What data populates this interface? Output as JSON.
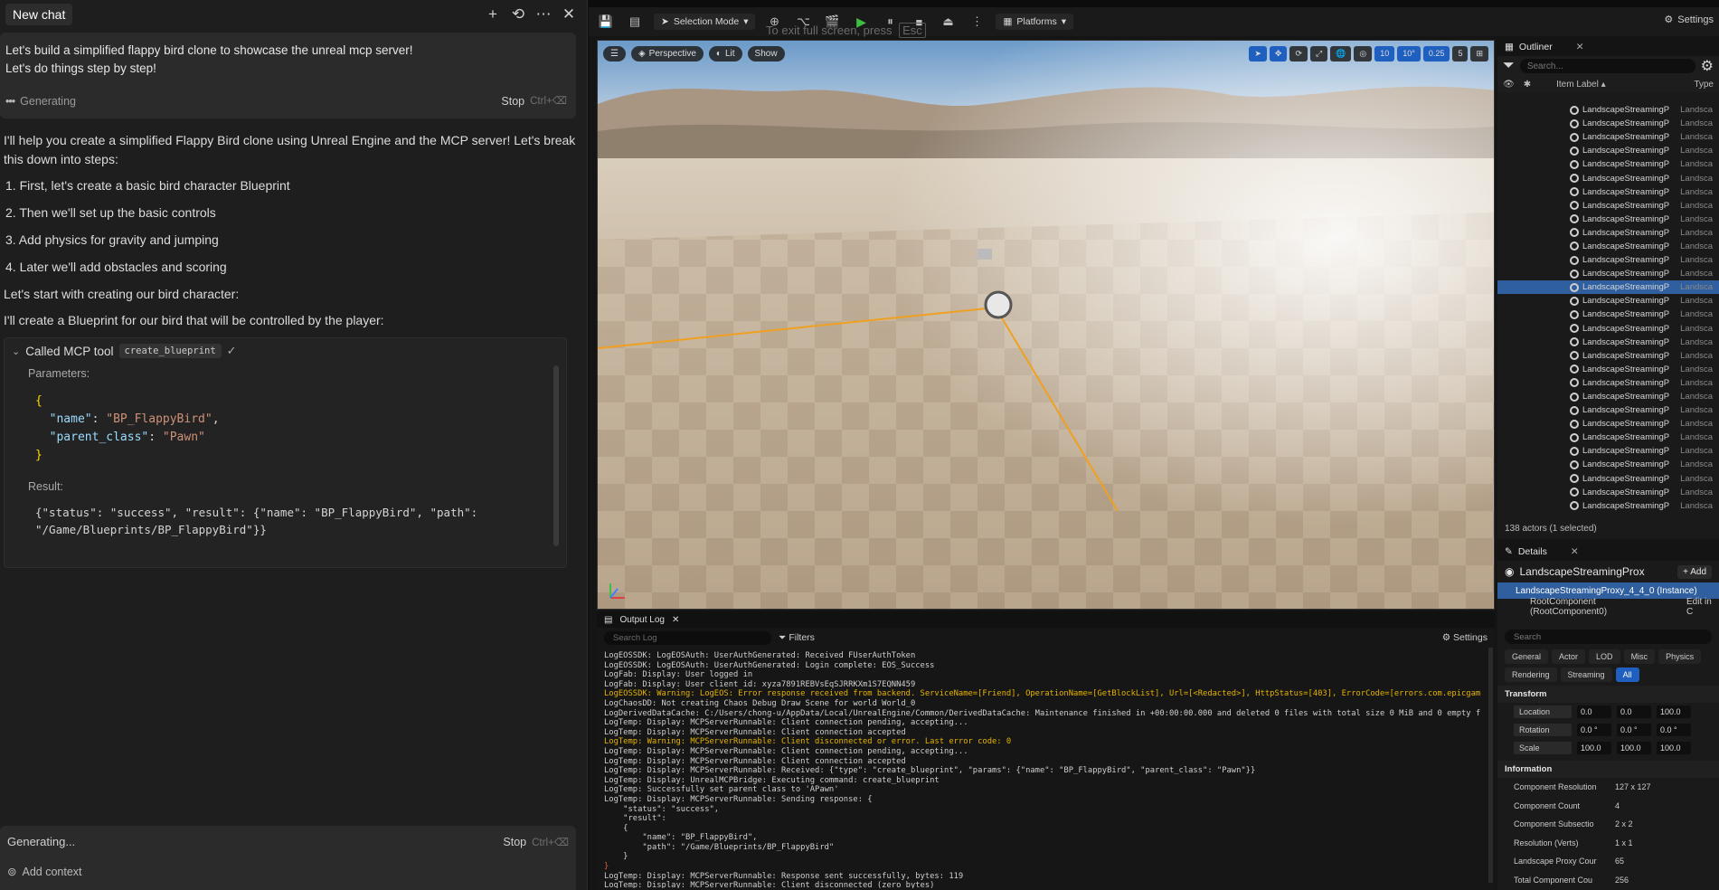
{
  "chat": {
    "title": "New chat",
    "header_icons": [
      "plus-icon",
      "history-icon",
      "more-icon",
      "close-icon"
    ],
    "user_message": {
      "line1": "Let's build a simplified flappy bird clone to showcase the unreal mcp server!",
      "line2": "Let's do things step by step!"
    },
    "status": "Generating",
    "stop_label": "Stop",
    "stop_shortcut": "Ctrl+⌫",
    "assistant": {
      "intro": "I'll help you create a simplified Flappy Bird clone using Unreal Engine and the MCP server! Let's break this down into steps:",
      "steps": [
        "1. First, let's create a basic bird character Blueprint",
        "2. Then we'll set up the basic controls",
        "3. Add physics for gravity and jumping",
        "4. Later we'll add obstacles and scoring"
      ],
      "para1": "Let's start with creating our bird character:",
      "para2": "I'll create a Blueprint for our bird that will be controlled by the player:"
    },
    "tool_call": {
      "label": "Called MCP tool",
      "tool_name": "create_blueprint",
      "parameters_label": "Parameters:",
      "param_name_key": "\"name\"",
      "param_name_val": "\"BP_FlappyBird\"",
      "param_parent_key": "\"parent_class\"",
      "param_parent_val": "\"Pawn\"",
      "result_label": "Result:",
      "result_line1": "{\"status\": \"success\", \"result\": {\"name\": \"BP_FlappyBird\", \"path\":",
      "result_line2": "\"/Game/Blueprints/BP_FlappyBird\"}}"
    },
    "input": {
      "status": "Generating...",
      "stop_label": "Stop",
      "stop_shortcut": "Ctrl+⌫",
      "add_context": "Add context"
    }
  },
  "editor": {
    "toolbar": {
      "selection_mode": "Selection Mode",
      "platforms": "Platforms",
      "settings": "Settings",
      "fullscreen_hint": "To exit full screen, press",
      "fullscreen_key": "Esc"
    },
    "viewport": {
      "perspective": "Perspective",
      "lit": "Lit",
      "show": "Show",
      "grid_snap": "10",
      "rot_snap": "10°",
      "scale_snap": "0.25",
      "camera_speed": "5"
    },
    "outliner": {
      "tab": "Outliner",
      "search_placeholder": "Search...",
      "col_label": "Item Label ▴",
      "col_type": "Type",
      "row_label": "LandscapeStreamingP",
      "row_type": "Landsca",
      "footer": "138 actors (1 selected)"
    },
    "details": {
      "tab": "Details",
      "actor_name": "LandscapeStreamingProx",
      "add_label": "+ Add",
      "instance": "LandscapeStreamingProxy_4_4_0 (Instance)",
      "root_component": "RootComponent (RootComponent0)",
      "edit_in": "Edit in C",
      "search_placeholder": "Search",
      "filters": [
        "General",
        "Actor",
        "LOD",
        "Misc",
        "Physics",
        "Rendering",
        "Streaming",
        "All"
      ],
      "transform_title": "Transform",
      "transform_rows": [
        {
          "label": "Location",
          "x": "0.0",
          "y": "0.0",
          "z": "100.0"
        },
        {
          "label": "Rotation",
          "x": "0.0 °",
          "y": "0.0 °",
          "z": "0.0 °"
        },
        {
          "label": "Scale",
          "x": "100.0",
          "y": "100.0",
          "z": "100.0"
        }
      ],
      "information_title": "Information",
      "info_rows": [
        {
          "label": "Component Resolution",
          "value": "127 x 127"
        },
        {
          "label": "Component Count",
          "value": "4"
        },
        {
          "label": "Component Subsectio",
          "value": "2 x 2"
        },
        {
          "label": "Resolution (Verts)",
          "value": "1 x 1"
        },
        {
          "label": "Landscape Proxy Cour",
          "value": "65"
        },
        {
          "label": "Total Component Cou",
          "value": "256"
        }
      ]
    },
    "output_log": {
      "tab": "Output Log",
      "search_placeholder": "Search Log",
      "filters": "Filters",
      "settings": "Settings",
      "lines": [
        {
          "t": "LogEOSSDK: LogEOSAuth: UserAuthGenerated: Received FUserAuthToken",
          "c": ""
        },
        {
          "t": "LogEOSSDK: LogEOSAuth: UserAuthGenerated: Login complete: EOS_Success",
          "c": ""
        },
        {
          "t": "LogFab: Display: User logged in",
          "c": ""
        },
        {
          "t": "LogFab: Display: User client id: xyza7891REBVsEqSJRRKXm1S7EQNN459",
          "c": ""
        },
        {
          "t": "LogEOSSDK: Warning: LogEOS: Error response received from backend. ServiceName=[Friend], OperationName=[GetBlockList], Url=[<Redacted>], HttpStatus=[403], ErrorCode=[errors.com.epicgam",
          "c": "w"
        },
        {
          "t": "LogChaosDD: Not creating Chaos Debug Draw Scene for world World_0",
          "c": ""
        },
        {
          "t": "LogDerivedDataCache: C:/Users/chong-u/AppData/Local/UnrealEngine/Common/DerivedDataCache: Maintenance finished in +00:00:00.000 and deleted 0 files with total size 0 MiB and 0 empty f",
          "c": ""
        },
        {
          "t": "LogTemp: Display: MCPServerRunnable: Client connection pending, accepting...",
          "c": ""
        },
        {
          "t": "LogTemp: Display: MCPServerRunnable: Client connection accepted",
          "c": ""
        },
        {
          "t": "LogTemp: Warning: MCPServerRunnable: Client disconnected or error. Last error code: 0",
          "c": "w"
        },
        {
          "t": "LogTemp: Display: MCPServerRunnable: Client connection pending, accepting...",
          "c": ""
        },
        {
          "t": "LogTemp: Display: MCPServerRunnable: Client connection accepted",
          "c": ""
        },
        {
          "t": "LogTemp: Display: MCPServerRunnable: Received: {\"type\": \"create_blueprint\", \"params\": {\"name\": \"BP_FlappyBird\", \"parent_class\": \"Pawn\"}}",
          "c": ""
        },
        {
          "t": "LogTemp: Display: UnrealMCPBridge: Executing command: create_blueprint",
          "c": ""
        },
        {
          "t": "LogTemp: Successfully set parent class to 'APawn'",
          "c": ""
        },
        {
          "t": "LogTemp: Display: MCPServerRunnable: Sending response: {",
          "c": ""
        },
        {
          "t": "    \"status\": \"success\",",
          "c": ""
        },
        {
          "t": "    \"result\":",
          "c": ""
        },
        {
          "t": "    {",
          "c": ""
        },
        {
          "t": "        \"name\": \"BP_FlappyBird\",",
          "c": ""
        },
        {
          "t": "        \"path\": \"/Game/Blueprints/BP_FlappyBird\"",
          "c": ""
        },
        {
          "t": "    }",
          "c": ""
        },
        {
          "t": "}",
          "c": "e"
        },
        {
          "t": "LogTemp: Display: MCPServerRunnable: Response sent successfully, bytes: 119",
          "c": ""
        },
        {
          "t": "LogTemp: Display: MCPServerRunnable: Client disconnected (zero bytes)",
          "c": ""
        }
      ]
    }
  },
  "colors": {
    "selection_blue": "#2f5f9f",
    "accent_blue": "#1f5fbf",
    "warning_yellow": "#e6b300",
    "selection_outline_orange": "#f0a020",
    "play_green": "#3fbf3f"
  }
}
